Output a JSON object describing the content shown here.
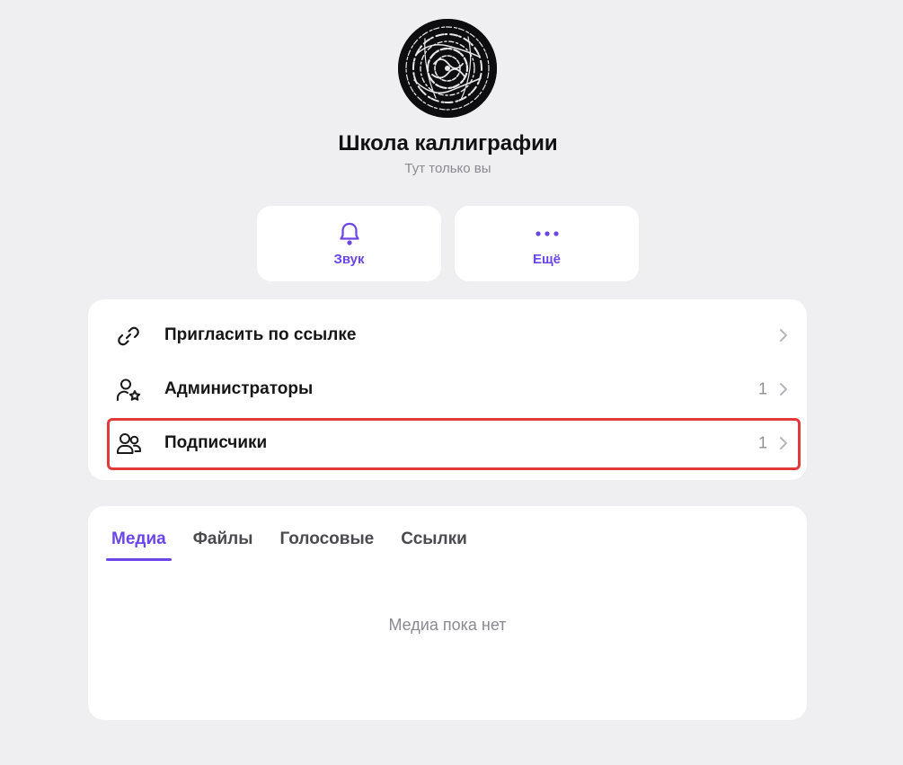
{
  "channel": {
    "title": "Школа каллиграфии",
    "subtitle": "Тут только вы"
  },
  "actions": {
    "sound_label": "Звук",
    "more_label": "Ещё"
  },
  "menu": {
    "invite_label": "Пригласить по ссылке",
    "admins_label": "Администраторы",
    "admins_count": "1",
    "subscribers_label": "Подписчики",
    "subscribers_count": "1"
  },
  "media": {
    "tabs": [
      "Медиа",
      "Файлы",
      "Голосовые",
      "Ссылки"
    ],
    "active_tab": "Медиа",
    "empty_text": "Медиа пока нет"
  },
  "icons": {
    "sound": "bell-icon",
    "more": "more-dots-icon",
    "invite": "link-icon",
    "admins": "user-star-icon",
    "subscribers": "users-icon",
    "chevron": "chevron-right-icon"
  },
  "colors": {
    "accent": "#6a45e8",
    "background": "#efeff2",
    "card": "#ffffff",
    "highlight": "#e03a3a",
    "muted": "#8a8a90"
  }
}
